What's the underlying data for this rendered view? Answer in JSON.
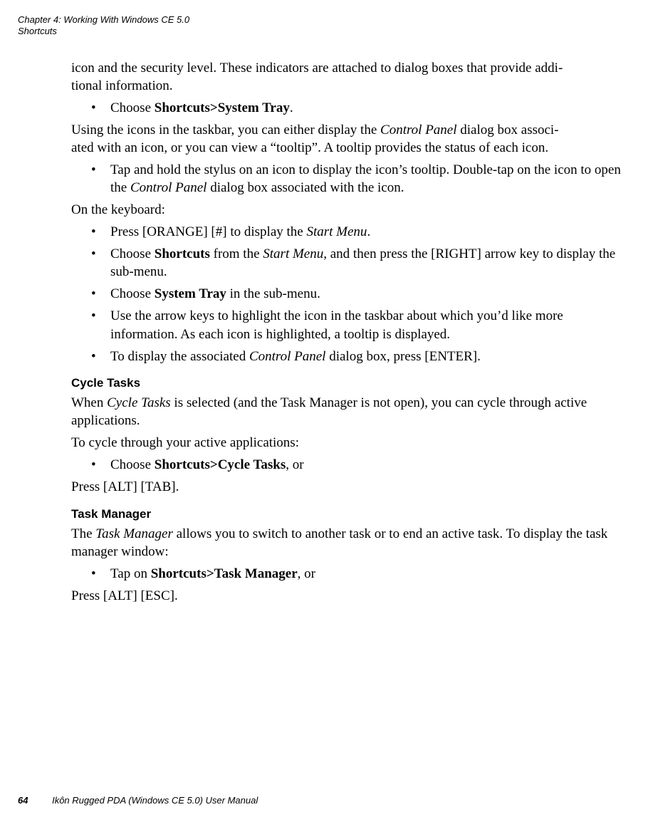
{
  "header": {
    "chapter": "Chapter 4:  Working With Windows CE 5.0",
    "section": "Shortcuts"
  },
  "body": {
    "p1_a": "icon and the security level. These indicators are attached to dialog boxes that provide addi",
    "p1_b": "tional information.",
    "li1_pre": "Choose ",
    "li1_bold": "Shortcuts>System Tray",
    "li1_post": ".",
    "p2_a": "Using the icons in the taskbar, you can either display the ",
    "p2_it1": "Control Panel",
    "p2_b": " dialog box associ",
    "p2_c": "ated with an icon, or you can view a “tooltip”. A tooltip provides the status of each icon.",
    "li2_a": "Tap and hold the stylus on an icon to display the icon’s tooltip. Double-tap on the icon to open the ",
    "li2_it": "Control Panel",
    "li2_b": " dialog box associated with the icon.",
    "p3": "On the keyboard:",
    "li3_a": "Press [ORANGE] [#] to display the ",
    "li3_it": "Start Menu",
    "li3_b": ".",
    "li4_a": "Choose ",
    "li4_bold": "Shortcuts",
    "li4_b": " from the ",
    "li4_it": "Start Menu",
    "li4_c": ", and then press the [RIGHT] arrow key to display the sub-menu.",
    "li5_a": "Choose ",
    "li5_bold": "System Tray",
    "li5_b": " in the sub-menu.",
    "li6": "Use the arrow keys to highlight the icon in the taskbar about which you’d like more information. As each icon is highlighted, a tooltip is displayed.",
    "li7_a": "To display the associated ",
    "li7_it": "Control Panel",
    "li7_b": " dialog box, press [ENTER].",
    "h1": "Cycle Tasks",
    "p4_a": "When ",
    "p4_it": "Cycle Tasks",
    "p4_b": " is selected (and the Task Manager is not open), you can cycle through active applications.",
    "p5": "To cycle through your active applications:",
    "li8_a": "Choose ",
    "li8_bold": "Shortcuts>Cycle Tasks",
    "li8_b": ", or",
    "p6": "Press [ALT] [TAB].",
    "h2": "Task Manager",
    "p7_a": "The ",
    "p7_it": "Task Manager",
    "p7_b": " allows you to switch to another task or to end an active task. To display the task manager window:",
    "li9_a": "Tap on ",
    "li9_bold": "Shortcuts>Task Manager",
    "li9_b": ", or",
    "p8": "Press [ALT] [ESC]."
  },
  "footer": {
    "page": "64",
    "title": "Ikôn Rugged PDA (Windows CE 5.0) User Manual"
  }
}
